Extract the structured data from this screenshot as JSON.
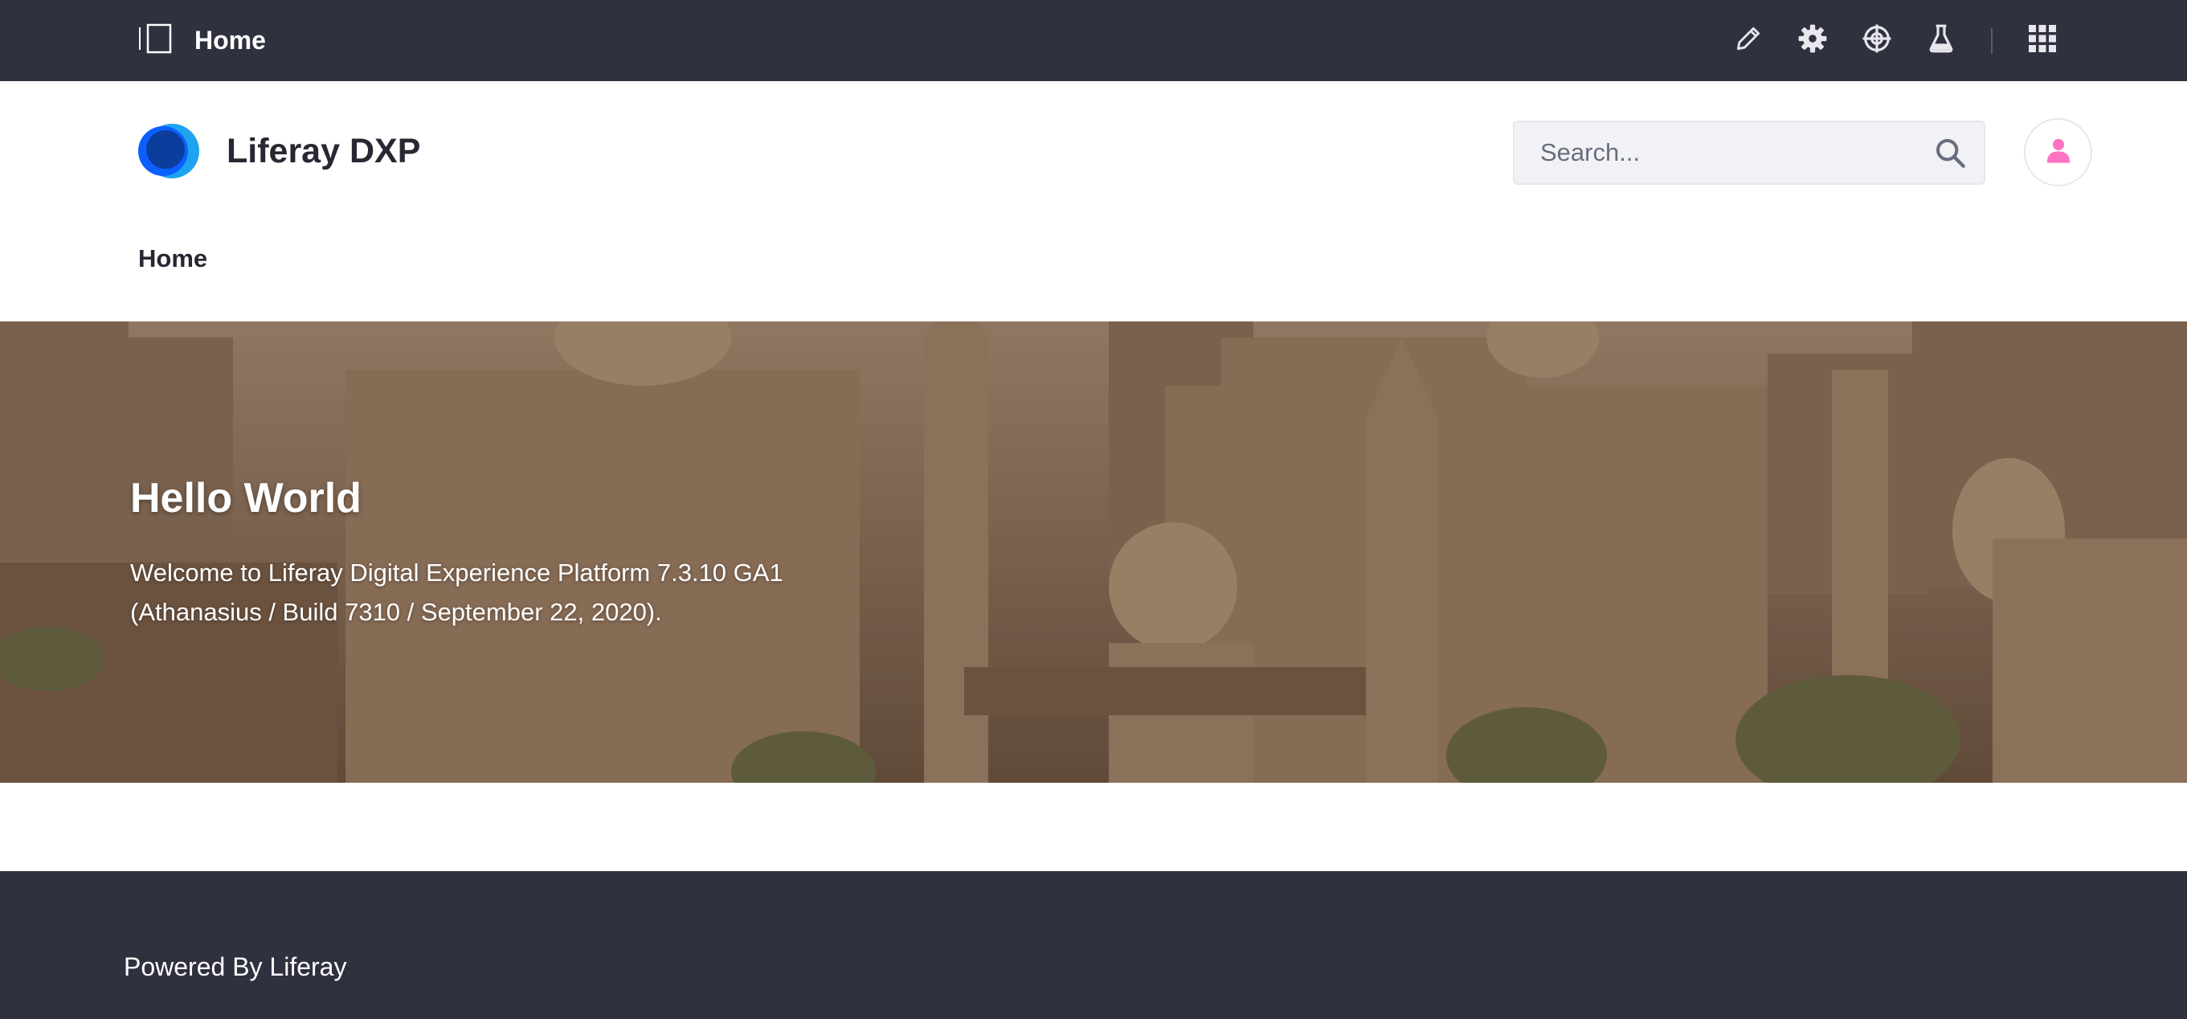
{
  "control_menu": {
    "title": "Home",
    "icons": [
      "sidebar-toggle-icon",
      "pencil-icon",
      "gear-icon",
      "target-icon",
      "flask-icon",
      "grid-icon"
    ]
  },
  "header": {
    "site_name": "Liferay DXP",
    "search": {
      "placeholder": "Search...",
      "value": ""
    }
  },
  "navigation": {
    "items": [
      {
        "label": "Home"
      }
    ]
  },
  "banner": {
    "title": "Hello World",
    "text_line_1": "Welcome to Liferay Digital Experience Platform 7.3.10 GA1",
    "text_line_2": "(Athanasius / Build 7310 / September 22, 2020)."
  },
  "footer": {
    "text": "Powered By Liferay"
  },
  "colors": {
    "control_menu_bg": "#30313f",
    "footer_bg": "#30313f",
    "brand_blue": "#0b5fff",
    "avatar_pink": "#ff73c3"
  }
}
